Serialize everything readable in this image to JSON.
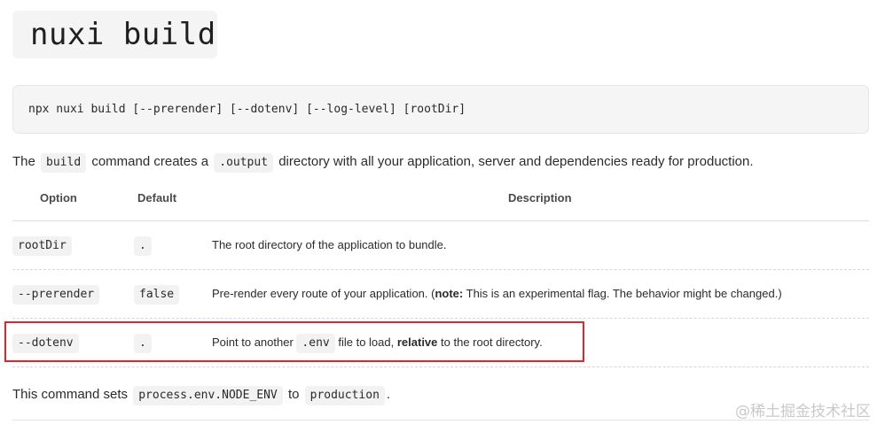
{
  "title": "nuxi build",
  "command": "npx nuxi build [--prerender] [--dotenv] [--log-level] [rootDir]",
  "intro": {
    "t1": "The",
    "c1": "build",
    "t2": "command creates a",
    "c2": ".output",
    "t3": "directory with all your application, server and dependencies ready for production."
  },
  "table": {
    "headers": {
      "option": "Option",
      "default": "Default",
      "description": "Description"
    },
    "rows": [
      {
        "option": "rootDir",
        "default": ".",
        "desc1": "The root directory of the application to bundle."
      },
      {
        "option": "--prerender",
        "default": "false",
        "desc1": "Pre-render every route of your application. (",
        "desc_bold": "note:",
        "desc2": " This is an experimental flag. The behavior might be changed.)"
      },
      {
        "option": "--dotenv",
        "default": ".",
        "desc1": "Point to another",
        "desc_code": ".env",
        "desc2": "file to load,",
        "desc_bold": "relative",
        "desc3": "to the root directory."
      }
    ]
  },
  "footer": {
    "t1": "This command sets",
    "c1": "process.env.NODE_ENV",
    "t2": "to",
    "c2": "production",
    "t3": "."
  },
  "watermark": "@稀土掘金技术社区",
  "colors": {
    "highlight_border": "#e0262b",
    "code_bg": "#f2f2f2"
  }
}
